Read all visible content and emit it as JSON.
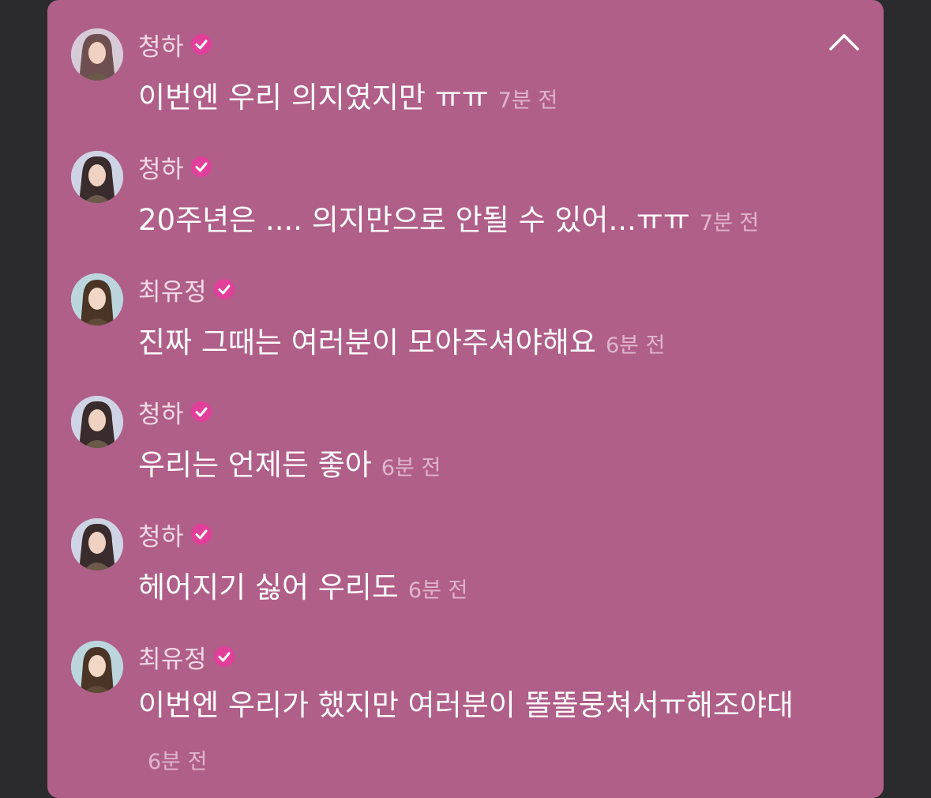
{
  "colors": {
    "panel_bg": "#b05f89",
    "backdrop": "#2b2a2e",
    "verified_badge": "#e23f9b",
    "name_text": "#f3d9e7",
    "time_text": "#e0b5cc"
  },
  "header": {
    "collapse_icon": "chevron-up-icon"
  },
  "messages": [
    {
      "author": "청하",
      "verified": true,
      "text": "이번엔 우리 의지였지만 ㅠㅠ",
      "time": "7분 전"
    },
    {
      "author": "청하",
      "verified": true,
      "text": "20주년은 .... 의지만으로 안될 수 있어...ㅠㅠ",
      "time": "7분 전"
    },
    {
      "author": "최유정",
      "verified": true,
      "text": "진짜 그때는 여러분이 모아주셔야해요",
      "time": "6분 전"
    },
    {
      "author": "청하",
      "verified": true,
      "text": "우리는 언제든 좋아",
      "time": "6분 전"
    },
    {
      "author": "청하",
      "verified": true,
      "text": "헤어지기 싫어 우리도",
      "time": "6분 전"
    },
    {
      "author": "최유정",
      "verified": true,
      "text": "이번엔 우리가 했지만 여러분이 똘똘뭉쳐서ㅠ해조야대",
      "time": "6분 전"
    }
  ]
}
